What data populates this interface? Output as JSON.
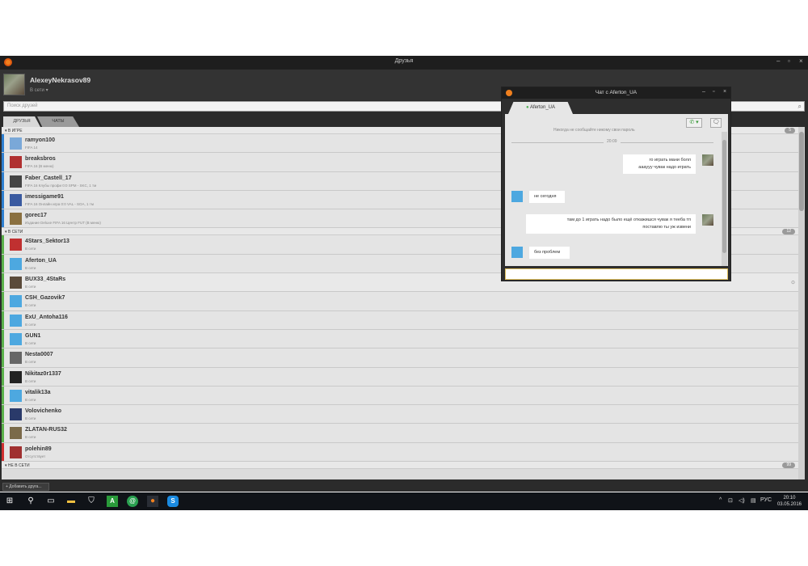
{
  "window": {
    "title": "Друзья"
  },
  "profile": {
    "username": "AlexeyNekrasov89",
    "status": "В сети  ▾"
  },
  "search": {
    "placeholder": "Поиск друзей"
  },
  "tabs": [
    {
      "label": "ДРУЗЬЯ"
    },
    {
      "label": "ЧАТЫ"
    }
  ],
  "sections": {
    "ingame": {
      "label": "▾ В ИГРЕ",
      "count": "5"
    },
    "online": {
      "label": "▾ В СЕТИ",
      "count": "12"
    },
    "offline": {
      "label": "▾ НЕ В СЕТИ",
      "count": "99"
    }
  },
  "ingame_friends": [
    {
      "name": "ramyon100",
      "status": "FIFA 14",
      "bar": "#2e7fd0",
      "av": "#7aa8d8"
    },
    {
      "name": "breaksbros",
      "status": "FIFA 16 (В меню)",
      "bar": "#2e7fd0",
      "av": "#b03030"
    },
    {
      "name": "Faber_Castell_17",
      "status": "FIFA 16 Клубы профи 0:0 SPM - SKC, 1 тм",
      "bar": "#2e7fd0",
      "av": "#444"
    },
    {
      "name": "imessigame91",
      "status": "FIFA 16 Онлайн игра 0:0 VAL - SOA, 1 тм",
      "bar": "#2e7fd0",
      "av": "#3a5aa0"
    },
    {
      "name": "gorec17",
      "status": "Издание Deluxe FIFA 16 Центр FUT (В меню)",
      "bar": "#2e7fd0",
      "av": "#8a7040"
    }
  ],
  "online_friends": [
    {
      "name": "4Stars_Sektor13",
      "status": "В сети",
      "bar": "#5ab04a",
      "av": "#c03030"
    },
    {
      "name": "Aferton_UA",
      "status": "В сети",
      "bar": "#5ab04a",
      "av": "#4da8e0"
    },
    {
      "name": "BUX33_4StaRs",
      "status": "В сети",
      "bar": "#5ab04a",
      "av": "#5a4a3a",
      "highlight": true
    },
    {
      "name": "CSH_Gazovik7",
      "status": "В сети",
      "bar": "#5ab04a",
      "av": "#4da8e0"
    },
    {
      "name": "ExU_Antoha116",
      "status": "В сети",
      "bar": "#5ab04a",
      "av": "#4da8e0"
    },
    {
      "name": "GUN1",
      "status": "В сети",
      "bar": "#5ab04a",
      "av": "#4da8e0"
    },
    {
      "name": "Nesta0007",
      "status": "В сети",
      "bar": "#5ab04a",
      "av": "#666"
    },
    {
      "name": "Nikitaz0r1337",
      "status": "В сети",
      "bar": "#5ab04a",
      "av": "#222"
    },
    {
      "name": "vitalik13a",
      "status": "В сети",
      "bar": "#5ab04a",
      "av": "#4da8e0"
    },
    {
      "name": "Volovichenko",
      "status": "В сети",
      "bar": "#5ab04a",
      "av": "#2a3a6a"
    },
    {
      "name": "ZLATAN-RUS32",
      "status": "В сети",
      "bar": "#5ab04a",
      "av": "#7a6a4a"
    },
    {
      "name": "polehin89",
      "status": "Отсутствует",
      "bar": "#d03030",
      "av": "#a03030"
    }
  ],
  "add_friend_label": "+ Добавить друга...",
  "chat": {
    "title": "Чат с Aferton_UA",
    "tab_label": "Aferton_UA",
    "cut_text": "Никогда не сообщайте никому свои пароль",
    "time": "20:09",
    "messages": [
      {
        "dir": "out",
        "lines": [
          "го играть мани болл",
          "аааууу чувак надо играть"
        ]
      },
      {
        "dir": "in",
        "lines": [
          "не сегодня"
        ]
      },
      {
        "dir": "out",
        "lines": [
          "там  до 1 играть надо было ещё откажишся чувак я тееба тп",
          "поставлю ты уж извени"
        ]
      },
      {
        "dir": "in",
        "lines": [
          "без проблем"
        ]
      }
    ]
  },
  "taskbar": {
    "lang": "РУС",
    "time": "20:10",
    "date": "03.05.2016"
  },
  "colors": {
    "accent": "#f0801e",
    "online": "#5ab04a",
    "ingame": "#2e7fd0",
    "away": "#d03030"
  }
}
